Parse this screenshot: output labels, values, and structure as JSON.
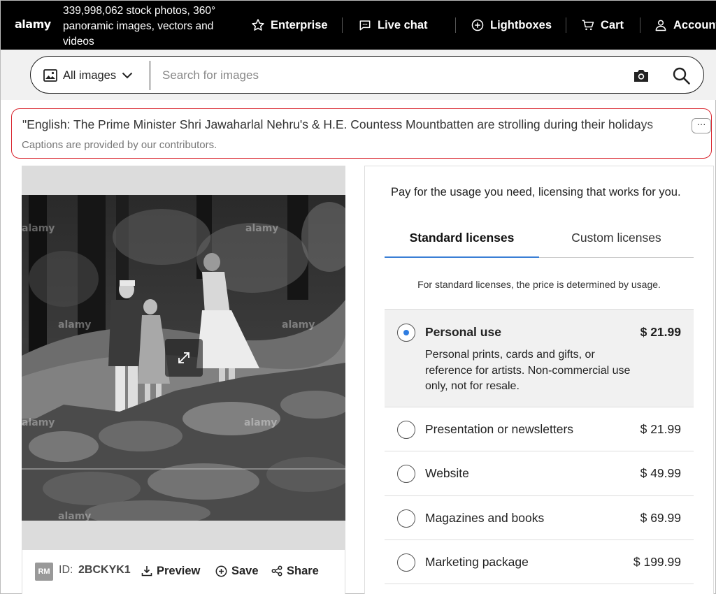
{
  "header": {
    "logo": "alamy",
    "tagline": "339,998,062 stock photos, 360° panoramic images, vectors and videos",
    "nav": [
      {
        "label": "Enterprise",
        "icon": "star-icon"
      },
      {
        "label": "Live chat",
        "icon": "chat-icon"
      },
      {
        "label": "Lightboxes",
        "icon": "plus-circle-icon"
      },
      {
        "label": "Cart",
        "icon": "cart-icon"
      },
      {
        "label": "Account",
        "icon": "user-icon"
      }
    ]
  },
  "search": {
    "scope_label": "All images",
    "placeholder": "Search for images"
  },
  "caption": {
    "title": "\"English: The Prime Minister Shri Jawaharlal Nehru's & H.E. Countess Mountbatten are strolling during their holidays",
    "more_label": "···",
    "note": "Captions are provided by our contributors."
  },
  "image": {
    "watermark": "alamy",
    "badge": "RM",
    "id_label": "ID:",
    "id_value": "2BCKYK1",
    "actions": {
      "preview": "Preview",
      "save": "Save",
      "share": "Share"
    }
  },
  "licenses": {
    "intro": "Pay for the usage you need, licensing that works for you.",
    "tabs": {
      "standard": "Standard licenses",
      "custom": "Custom licenses"
    },
    "note": "For standard licenses, the price is determined by usage.",
    "options": [
      {
        "name": "Personal use",
        "price": "$ 21.99",
        "selected": true,
        "description": "Personal prints, cards and gifts, or reference for artists. Non-commercial use only, not for resale."
      },
      {
        "name": "Presentation or newsletters",
        "price": "$ 21.99",
        "selected": false
      },
      {
        "name": "Website",
        "price": "$ 49.99",
        "selected": false
      },
      {
        "name": "Magazines and books",
        "price": "$ 69.99",
        "selected": false
      },
      {
        "name": "Marketing package",
        "price": "$ 199.99",
        "selected": false
      }
    ]
  },
  "colors": {
    "header_bg": "#000000",
    "caption_border": "#d9262f",
    "radio_selected": "#2f7de1",
    "tab_active_underline": "#3a7fd5"
  }
}
